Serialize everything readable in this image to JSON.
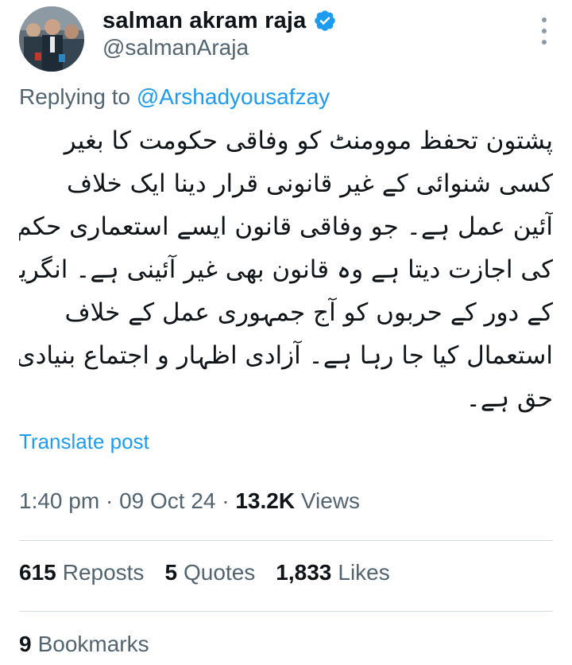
{
  "author": {
    "name": "salman akram raja",
    "handle": "@salmanAraja"
  },
  "reply": {
    "prefix": "Replying to",
    "mention": "@Arshadyousafzay"
  },
  "tweet": {
    "lines": [
      "پشتون تحفظ موومنٹ کو وفاقی حکومت کا بغیر",
      "کسی شنوائی کے غیر قانونی قرار دینا ایک خلاف",
      "آئین عمل ہے۔ جو وفاقی قانون ایسے استعماری حکم",
      "کی اجازت دیتا ہے وہ قانون بھی غیر آئینی ہے۔ انگریز",
      "کے دور کے حربوں کو آج جمہوری عمل کے خلاف",
      "استعمال کیا جا رہا ہے۔ آزادی اظہار و اجتماع بنیادی",
      "حق ہے۔"
    ]
  },
  "translate_label": "Translate post",
  "meta": {
    "time": "1:40 pm",
    "date": "09 Oct 24",
    "separator": "·",
    "views_count": "13.2K",
    "views_label": "Views"
  },
  "stats": {
    "reposts_count": "615",
    "reposts_label": "Reposts",
    "quotes_count": "5",
    "quotes_label": "Quotes",
    "likes_count": "1,833",
    "likes_label": "Likes"
  },
  "bookmarks": {
    "count": "9",
    "label": "Bookmarks"
  },
  "colors": {
    "link": "#1d9bf0",
    "secondary_text": "#536471",
    "primary_text": "#0f1419",
    "divider": "#cfd9de",
    "verified": "#1d9bf0"
  },
  "icons": [
    "verified-badge-icon",
    "more-options-icon"
  ]
}
